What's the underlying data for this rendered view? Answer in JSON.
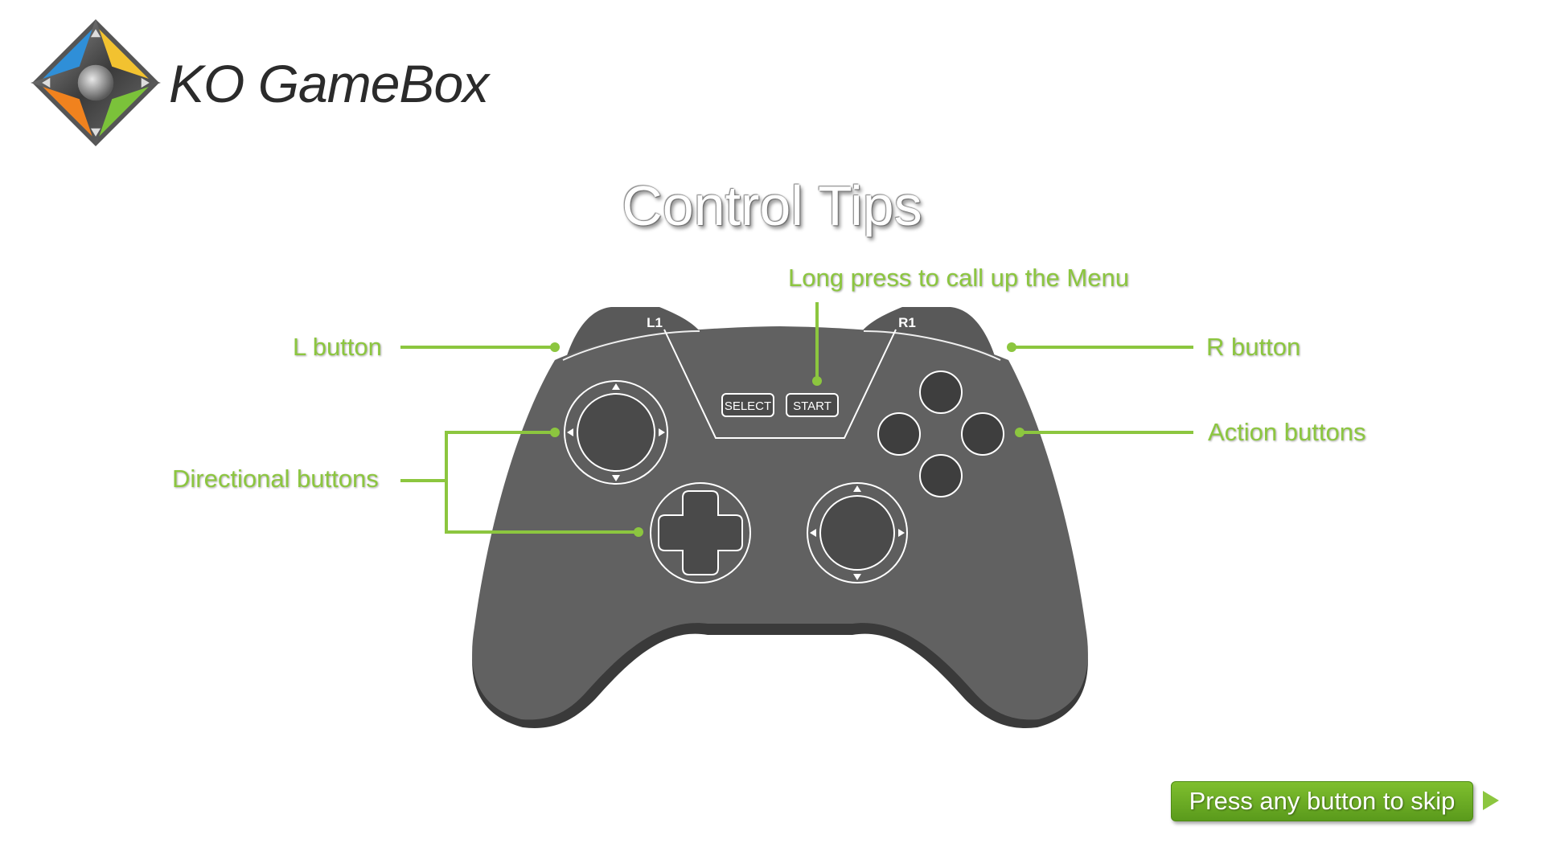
{
  "app": {
    "name": "KO GameBox",
    "logo_icon": "gamebox-dpad-logo-icon"
  },
  "page_title": "Control Tips",
  "controller": {
    "l1_label": "L1",
    "r1_label": "R1",
    "select_label": "SELECT",
    "start_label": "START",
    "body_color": "#616161",
    "shadow_color": "#3a3a3a"
  },
  "callouts": {
    "l_button": "L button",
    "r_button": "R button",
    "menu": "Long press to call up the Menu",
    "directional": "Directional buttons",
    "action": "Action buttons"
  },
  "skip": {
    "label": "Press any button to skip",
    "arrow_icon": "play-arrow-icon"
  },
  "colors": {
    "accent": "#8cc63f",
    "button_green": "#6aaa24",
    "title": "#ffffff"
  }
}
